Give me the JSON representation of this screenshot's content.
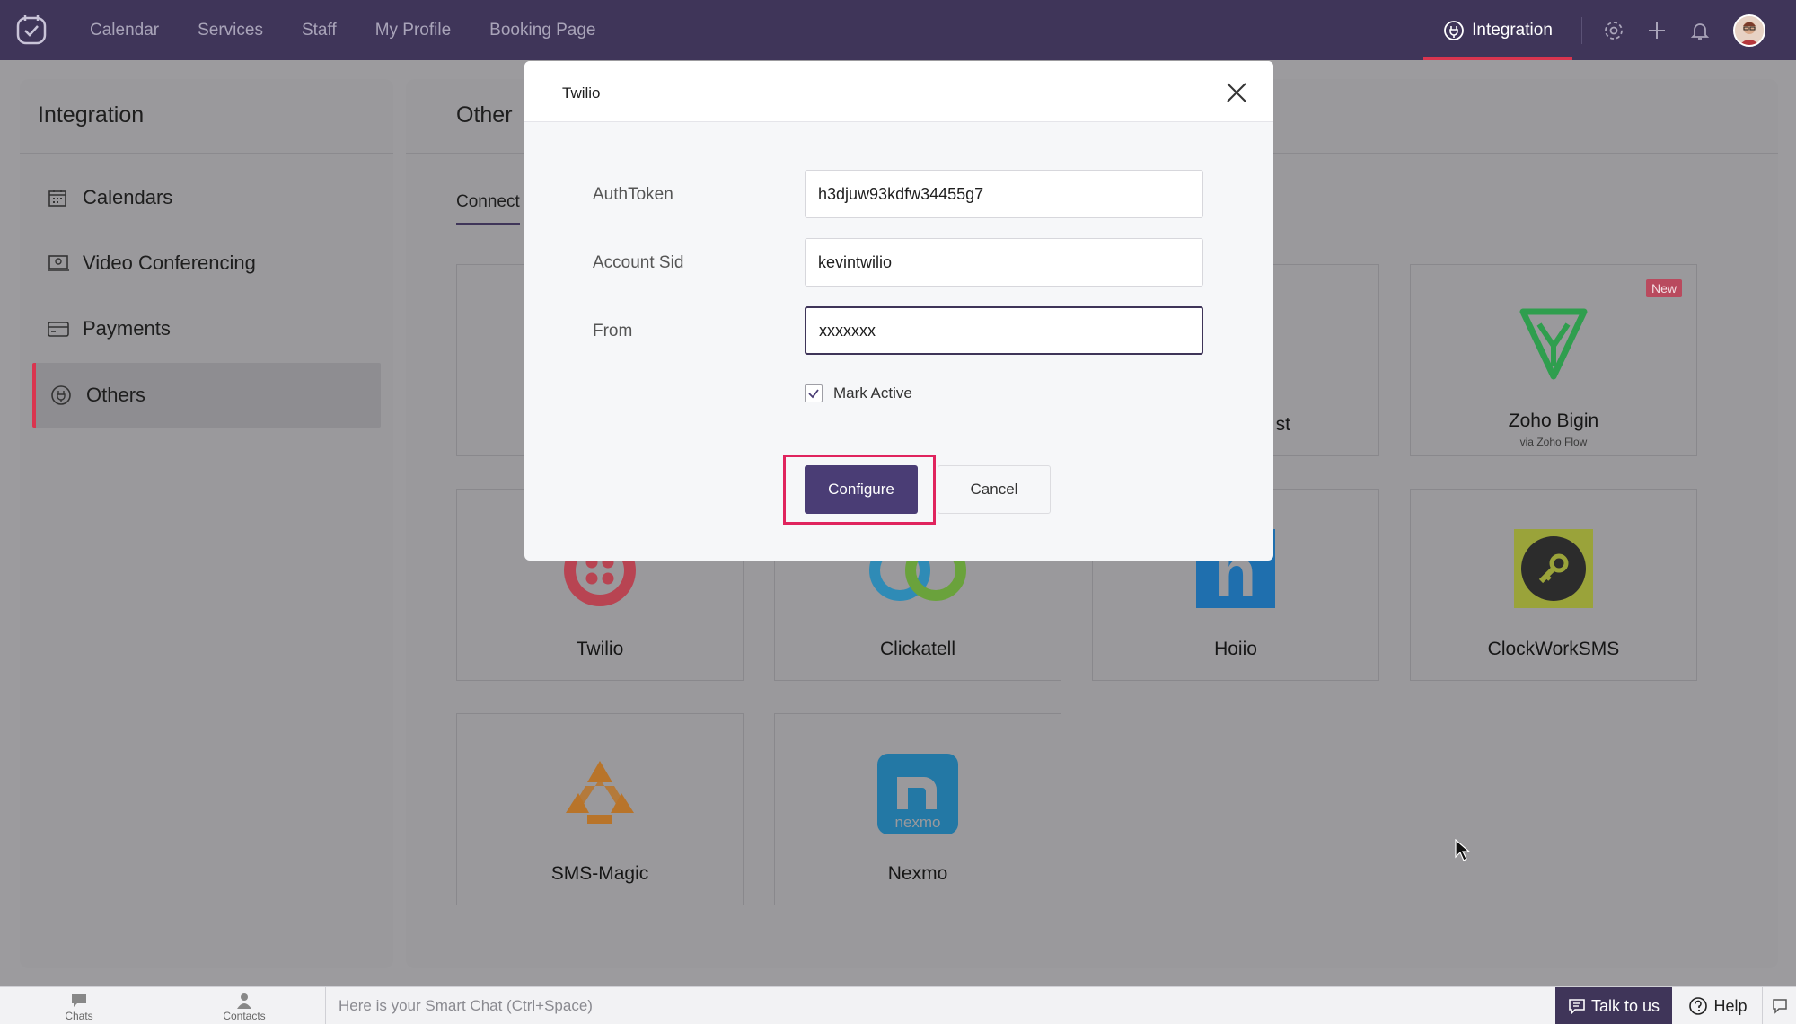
{
  "nav": {
    "links": [
      "Calendar",
      "Services",
      "Staff",
      "My Profile",
      "Booking Page"
    ],
    "active_tab": "Integration"
  },
  "sidebar": {
    "title": "Integration",
    "items": [
      {
        "label": "Calendars",
        "icon": "calendar-icon"
      },
      {
        "label": "Video Conferencing",
        "icon": "video-icon"
      },
      {
        "label": "Payments",
        "icon": "credit-card-icon"
      },
      {
        "label": "Others",
        "icon": "plug-icon",
        "active": true
      }
    ]
  },
  "main": {
    "title": "Other",
    "tab_connect": "Connect",
    "cards": [
      {
        "label": "Twilio"
      },
      {
        "label": "Clickatell"
      },
      {
        "label": "Hoiio"
      },
      {
        "label": "ClockWorkSMS"
      },
      {
        "label": "SMS-Magic"
      },
      {
        "label": "Nexmo"
      },
      {
        "label": "Zoho Bigin",
        "sub": "via Zoho Flow",
        "badge": "New"
      },
      {
        "label": "st"
      }
    ]
  },
  "modal": {
    "title": "Twilio",
    "fields": [
      {
        "label": "AuthToken",
        "value": "h3djuw93kdfw34455g7"
      },
      {
        "label": "Account Sid",
        "value": "kevintwilio"
      },
      {
        "label": "From",
        "value": "xxxxxxx"
      }
    ],
    "checkbox_label": "Mark Active",
    "checkbox_checked": true,
    "configure_label": "Configure",
    "cancel_label": "Cancel"
  },
  "bottombar": {
    "chats": "Chats",
    "contacts": "Contacts",
    "chat_placeholder": "Here is your Smart Chat (Ctrl+Space)",
    "talk": "Talk to us",
    "help": "Help"
  },
  "colors": {
    "nav_bg": "#3f3559",
    "accent_red": "#d9354f",
    "primary_button": "#4a3d75",
    "highlight": "#e0245e"
  }
}
